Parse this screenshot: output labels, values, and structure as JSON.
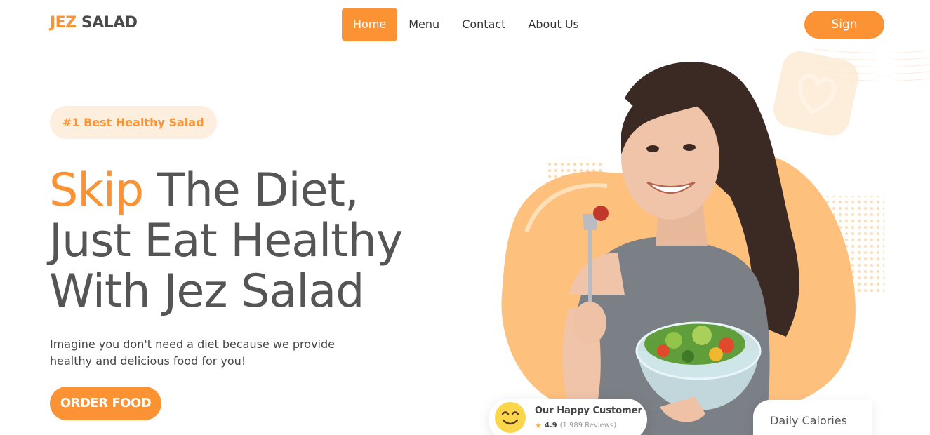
{
  "brand": {
    "part1": "JEZ",
    "part2": "SALAD"
  },
  "nav": {
    "items": [
      {
        "label": "Home",
        "active": true
      },
      {
        "label": "Menu",
        "active": false
      },
      {
        "label": "Contact",
        "active": false
      },
      {
        "label": "About Us",
        "active": false
      }
    ]
  },
  "sign_label": "Sign",
  "hero": {
    "badge": "#1 Best Healthy Salad",
    "headline_accent": "Skip",
    "headline_line1_rest": " The Diet,",
    "headline_line2": "Just Eat Healthy",
    "headline_line3": "With Jez Salad",
    "subtext_line1": "Imagine you don't need a diet because we provide",
    "subtext_line2": "healthy and delicious food for you!",
    "order_label": "ORDER FOOD"
  },
  "customer_card": {
    "title": "Our Happy Customer",
    "rating": "4.9",
    "reviews": "(1.989 Reviews)",
    "icon": "smiley-face-icon"
  },
  "calories_card": {
    "label": "Daily Calories"
  },
  "colors": {
    "accent": "#fb9334",
    "accent_soft": "#fdeede",
    "text": "#555555"
  }
}
